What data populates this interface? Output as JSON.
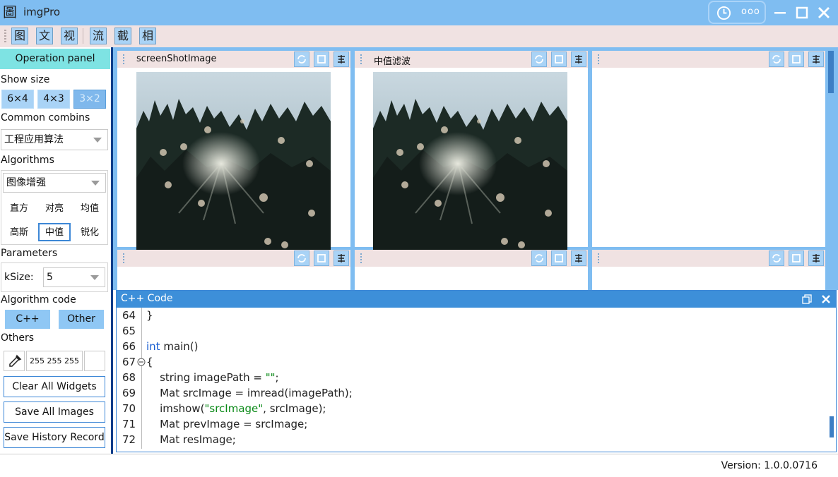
{
  "app": {
    "title": "imgPro",
    "logo_glyph": "圖",
    "more_label": "ooo"
  },
  "colors": {
    "titlebar": "#7fbdf1",
    "accent": "#3d8fd9",
    "toolbar": "#f0e2e2",
    "op_header": "#7ee3e3"
  },
  "toolbar": {
    "buttons": [
      "图",
      "文",
      "视",
      "流",
      "截",
      "相"
    ]
  },
  "left_panel": {
    "header": "Operation panel",
    "show_size_label": "Show size",
    "sizes": [
      {
        "label": "6×4"
      },
      {
        "label": "4×3"
      },
      {
        "label": "3×2"
      }
    ],
    "selected_size": "3×2",
    "common_combins_label": "Common combins",
    "common_combins_value": "工程应用算法",
    "algorithms_label": "Algorithms",
    "algorithms_value": "图像增强",
    "algorithm_items": [
      "直方",
      "对亮",
      "均值",
      "高斯",
      "中值",
      "锐化"
    ],
    "selected_algorithm": "中值",
    "parameters_label": "Parameters",
    "ksize_label": "kSize:",
    "ksize_value": "5",
    "algorithm_code_label": "Algorithm code",
    "code_buttons": [
      "C++",
      "Other"
    ],
    "others_label": "Others",
    "color_value": "255 255 255",
    "clear_button": "Clear All Widgets",
    "save_images_button": "Save All Images",
    "save_history_button": "Save History Record"
  },
  "grid": {
    "cells": [
      {
        "title": "screenShotImage",
        "has_image": true
      },
      {
        "title": "中值滤波",
        "has_image": true
      },
      {
        "title": "",
        "has_image": false
      },
      {
        "title": "",
        "has_image": false
      },
      {
        "title": "",
        "has_image": false
      },
      {
        "title": "",
        "has_image": false
      }
    ]
  },
  "code_panel": {
    "title": "C++ Code",
    "lines": [
      {
        "n": "64",
        "text": "}"
      },
      {
        "n": "65",
        "text": ""
      },
      {
        "n": "66",
        "text": "int main()"
      },
      {
        "n": "67",
        "text": "{"
      },
      {
        "n": "68",
        "text": "    string imagePath = \"\";"
      },
      {
        "n": "69",
        "text": "    Mat srcImage = imread(imagePath);"
      },
      {
        "n": "70",
        "text": "    imshow(\"srcImage\", srcImage);"
      },
      {
        "n": "71",
        "text": "    Mat prevImage = srcImage;"
      },
      {
        "n": "72",
        "text": "    Mat resImage;"
      }
    ]
  },
  "status": {
    "version": "Version: 1.0.0.0716"
  }
}
